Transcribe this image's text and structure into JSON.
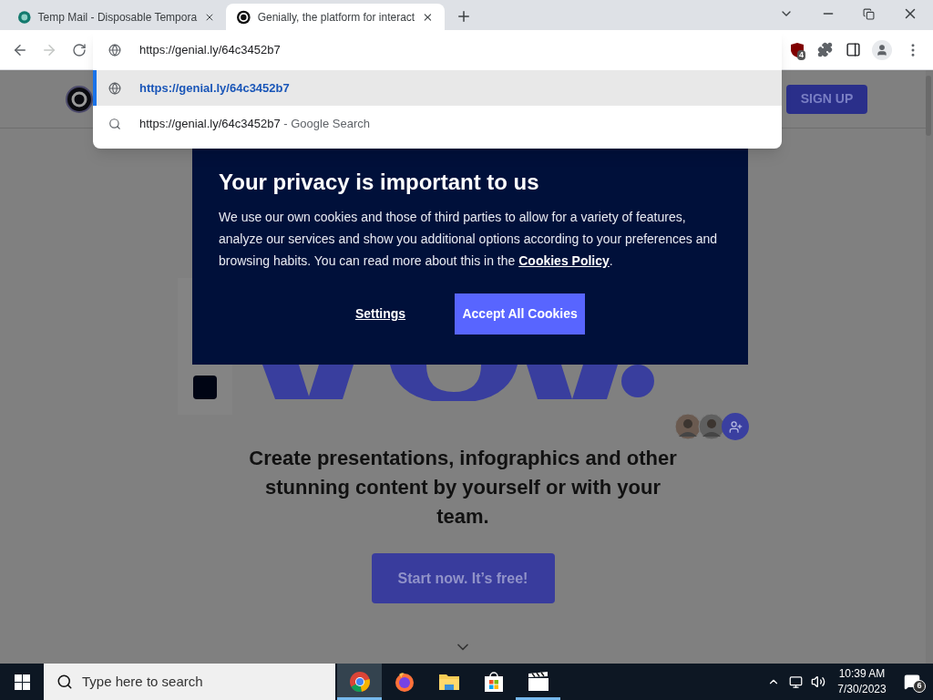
{
  "tabs": [
    {
      "title": "Temp Mail - Disposable Tempora",
      "selected": false
    },
    {
      "title": "Genially, the platform for interact",
      "selected": true
    }
  ],
  "address_bar": {
    "value": "https://genial.ly/64c3452b7"
  },
  "extension_badge": "4",
  "suggestions": [
    {
      "kind": "url",
      "text": "https://genial.ly/64c3452b7",
      "selected": true
    },
    {
      "kind": "search",
      "text": "https://genial.ly/64c3452b7",
      "suffix": "- Google Search",
      "selected": false
    }
  ],
  "page": {
    "signup": "SIGN UP",
    "headline": "Create presentations, infographics and other stunning content by yourself or with your team.",
    "cta": "Start now. It’s free!"
  },
  "cookie_dialog": {
    "title": "Your privacy is important to us",
    "body": "We use our own cookies and those of third parties to allow for a variety of features, analyze our services and show you additional options according to your preferences and browsing habits. You can read more about this in the ",
    "link": "Cookies Policy",
    "body_end": ".",
    "settings": "Settings",
    "accept": "Accept All Cookies"
  },
  "taskbar": {
    "search_placeholder": "Type here to search",
    "apps": [
      {
        "kind": "chrome",
        "selected": true,
        "running": true
      },
      {
        "kind": "firefox",
        "selected": false,
        "running": false
      },
      {
        "kind": "folder",
        "selected": false,
        "running": false
      },
      {
        "kind": "store",
        "selected": false,
        "running": false
      },
      {
        "kind": "clapper",
        "selected": false,
        "running": true
      }
    ],
    "time": "10:39 AM",
    "date": "7/30/2023",
    "notifications": "6"
  }
}
